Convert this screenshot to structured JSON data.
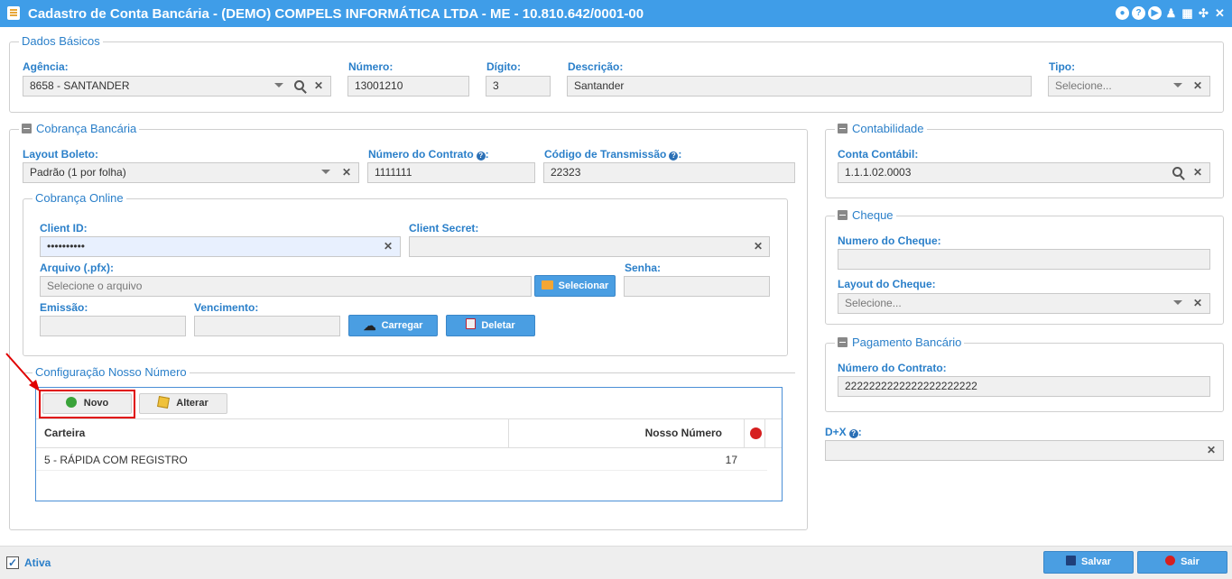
{
  "window": {
    "title": "Cadastro de Conta Bancária - (DEMO) COMPELS INFORMÁTICA LTDA - ME - 10.810.642/0001-00",
    "icons": [
      "record-icon",
      "help-icon",
      "play-icon",
      "user-icon",
      "calendar-icon",
      "compress-icon",
      "close-icon"
    ]
  },
  "dados_basicos": {
    "legend": "Dados Básicos",
    "agencia_label": "Agência:",
    "agencia_value": "8658 - SANTANDER",
    "numero_label": "Número:",
    "numero_value": "13001210",
    "digito_label": "Dígito:",
    "digito_value": "3",
    "descricao_label": "Descrição:",
    "descricao_value": "Santander",
    "tipo_label": "Tipo:",
    "tipo_placeholder": "Selecione..."
  },
  "cobranca": {
    "legend": "Cobrança Bancária",
    "layout_label": "Layout Boleto:",
    "layout_value": "Padrão (1 por folha)",
    "contrato_label": "Número do Contrato",
    "contrato_value": "1111111",
    "transmissao_label": "Código de Transmissão",
    "transmissao_value": "22323"
  },
  "online": {
    "legend": "Cobrança Online",
    "client_id_label": "Client ID:",
    "client_id_value": "••••••••••",
    "client_secret_label": "Client Secret:",
    "client_secret_value": "",
    "arquivo_label": "Arquivo (.pfx):",
    "arquivo_placeholder": "Selecione o arquivo",
    "selecionar_label": "Selecionar",
    "senha_label": "Senha:",
    "emissao_label": "Emissão:",
    "vencimento_label": "Vencimento:",
    "carregar_label": "Carregar",
    "deletar_label": "Deletar"
  },
  "nosso_numero": {
    "legend": "Configuração Nosso Número",
    "novo_label": "Novo",
    "alterar_label": "Alterar",
    "columns": [
      "Carteira",
      "Nosso Número"
    ],
    "rows": [
      {
        "carteira": "5 - RÁPIDA COM REGISTRO",
        "nosso_numero": "17"
      }
    ]
  },
  "contabilidade": {
    "legend": "Contabilidade",
    "conta_label": "Conta Contábil:",
    "conta_value": "1.1.1.02.0003"
  },
  "cheque": {
    "legend": "Cheque",
    "numero_label": "Numero do Cheque:",
    "numero_value": "",
    "layout_label": "Layout do Cheque:",
    "layout_placeholder": "Selecione..."
  },
  "pagamento": {
    "legend": "Pagamento Bancário",
    "contrato_label": "Número do Contrato:",
    "contrato_value": "2222222222222222222222"
  },
  "dx": {
    "label": "D+X",
    "value": ""
  },
  "footer": {
    "ativa_label": "Ativa",
    "salvar_label": "Salvar",
    "sair_label": "Sair"
  },
  "colors": {
    "titlebar": "#3f9de8",
    "accent_text": "#2a7fc9",
    "button": "#4a9ee2",
    "highlight": "#e00000"
  }
}
